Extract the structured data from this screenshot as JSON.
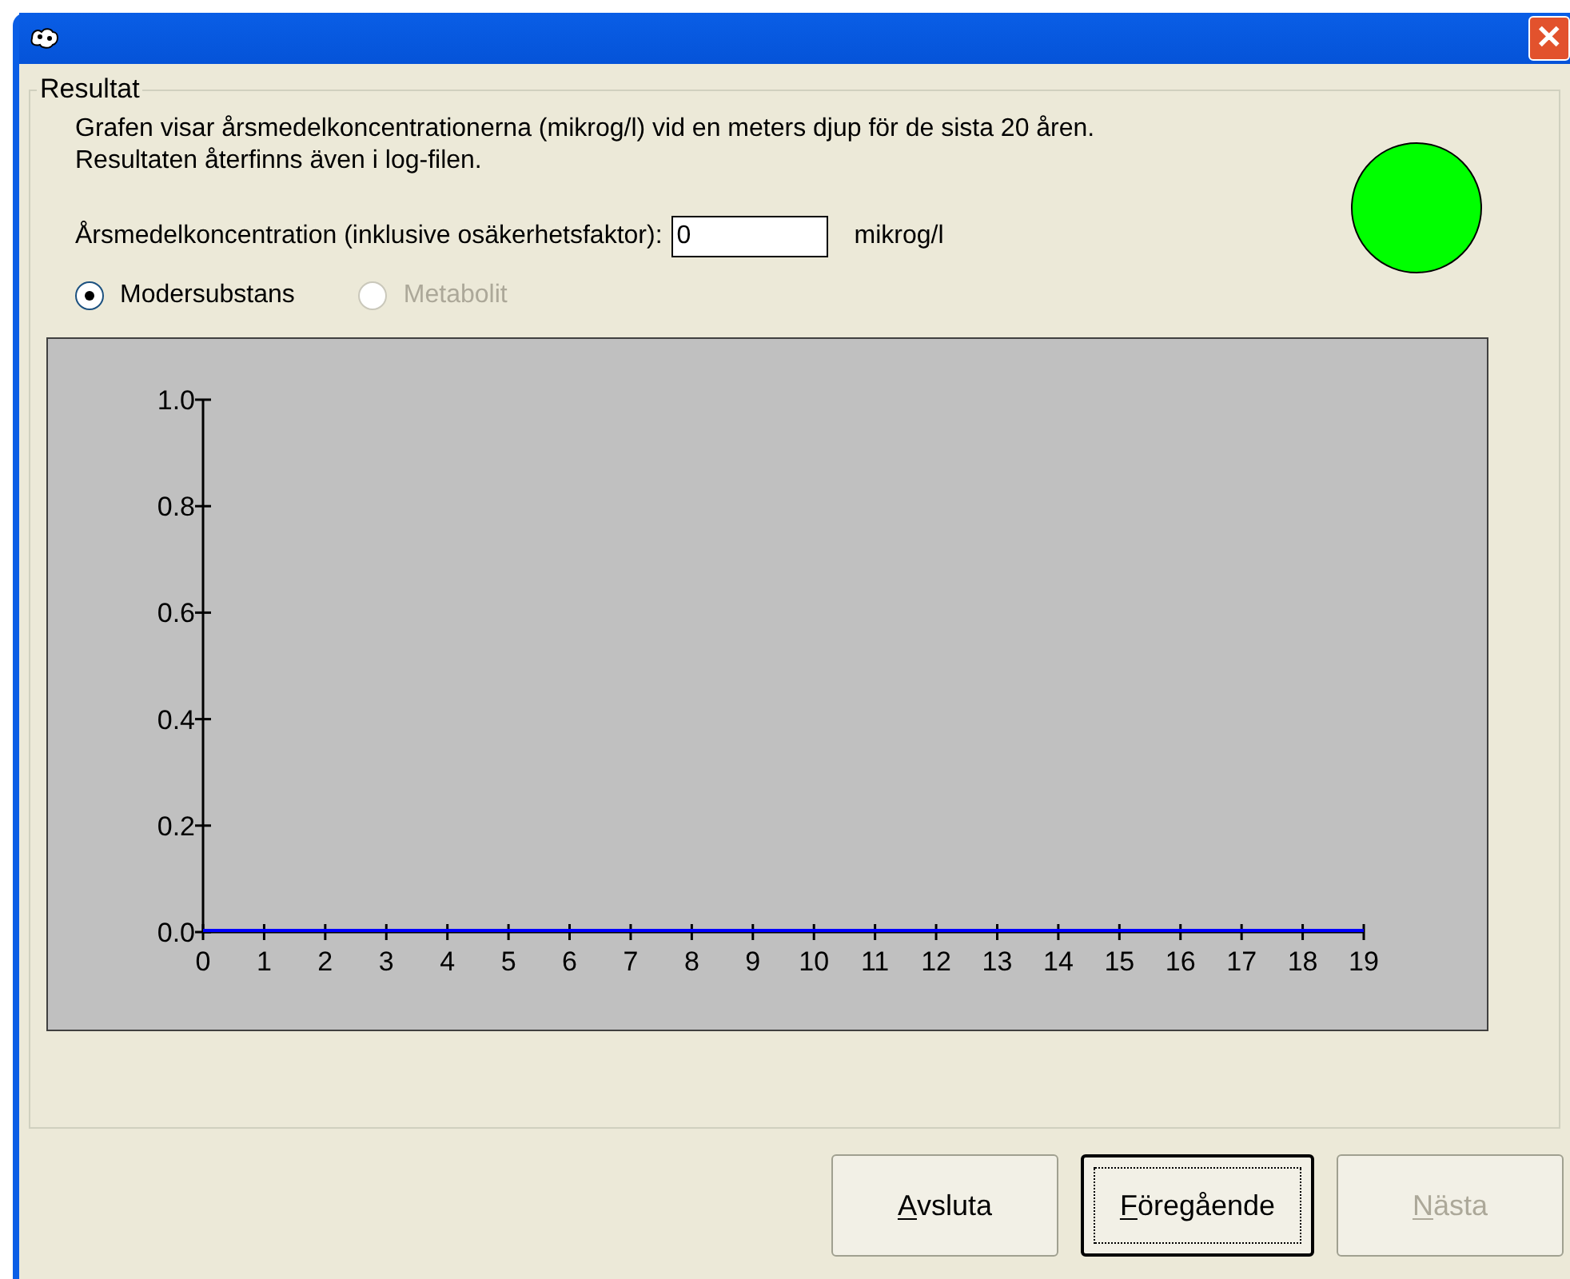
{
  "window": {
    "close_button": "✕"
  },
  "group": {
    "title": "Resultat",
    "description": "Grafen visar årsmedelkoncentrationerna (mikrog/l) vid en meters djup för de sista 20 åren. Resultaten återfinns även i log-filen.",
    "status_light": {
      "color": "#00ff00"
    },
    "concentration": {
      "label": "Årsmedelkoncentration (inklusive osäkerhetsfaktor):",
      "value": "0",
      "unit": "mikrog/l"
    },
    "substances": [
      {
        "label": "Modersubstans",
        "selected": true,
        "disabled": false
      },
      {
        "label": "Metabolit",
        "selected": false,
        "disabled": true
      }
    ],
    "chart": {
      "chart_data": {
        "type": "line",
        "x": [
          0,
          1,
          2,
          3,
          4,
          5,
          6,
          7,
          8,
          9,
          10,
          11,
          12,
          13,
          14,
          15,
          16,
          17,
          18,
          19
        ],
        "series": [
          {
            "color": "#0000ff",
            "values": [
              0,
              0,
              0,
              0,
              0,
              0,
              0,
              0,
              0,
              0,
              0,
              0,
              0,
              0,
              0,
              0,
              0,
              0,
              0,
              0
            ]
          }
        ],
        "xlim": [
          0,
          19
        ],
        "ylim": [
          0,
          1
        ],
        "xticks": [
          0,
          1,
          2,
          3,
          4,
          5,
          6,
          7,
          8,
          9,
          10,
          11,
          12,
          13,
          14,
          15,
          16,
          17,
          18,
          19
        ],
        "yticks": [
          {
            "value": 0,
            "label": "0.0"
          },
          {
            "value": 0.2,
            "label": "0.2"
          },
          {
            "value": 0.4,
            "label": "0.4"
          },
          {
            "value": 0.6,
            "label": "0.6"
          },
          {
            "value": 0.8,
            "label": "0.8"
          },
          {
            "value": 1,
            "label": "1.0"
          }
        ]
      }
    }
  },
  "buttons": [
    {
      "label": "Avsluta",
      "focused": false,
      "disabled": false
    },
    {
      "label": "Föregående",
      "focused": true,
      "disabled": false
    },
    {
      "label": "Nästa",
      "focused": false,
      "disabled": true
    }
  ]
}
